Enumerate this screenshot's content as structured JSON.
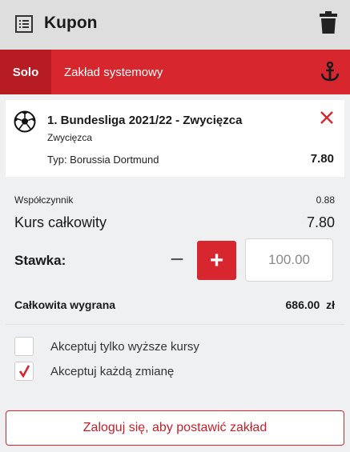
{
  "header": {
    "title": "Kupon",
    "list_icon": "list-icon",
    "trash_icon": "trash-icon"
  },
  "tabs": {
    "solo": "Solo",
    "system": "Zakład systemowy",
    "anchor_icon": "anchor-icon"
  },
  "bet": {
    "icon": "soccer-ball-icon",
    "title": "1. Bundesliga 2021/22 - Zwycięzca",
    "market": "Zwycięzca",
    "selection": "Typ: Borussia Dortmund",
    "odds": "7.80",
    "remove_icon": "close-icon"
  },
  "summary": {
    "coefficient_label": "Współczynnik",
    "coefficient_value": "0.88",
    "total_odds_label": "Kurs całkowity",
    "total_odds_value": "7.80",
    "stake_label": "Stawka:",
    "stake_minus": "−",
    "stake_plus": "+",
    "stake_value": "100.00",
    "total_win_label": "Całkowita wygrana",
    "total_win_value": "686.00  zł"
  },
  "options": [
    {
      "label": "Akceptuj tylko wyższe kursy",
      "checked": false
    },
    {
      "label": "Akceptuj każdą zmianę",
      "checked": true
    }
  ],
  "login_button": "Zaloguj się, aby postawić zakład",
  "colors": {
    "accent": "#d8262e",
    "accent_dark": "#b81c23",
    "background": "#eef0f1",
    "header_bg": "#dedede"
  }
}
